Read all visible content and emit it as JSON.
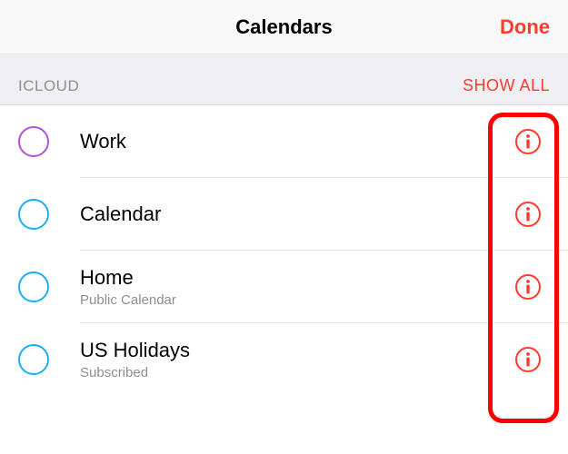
{
  "header": {
    "title": "Calendars",
    "done_label": "Done"
  },
  "section": {
    "label": "ICLOUD",
    "show_all_label": "SHOW ALL"
  },
  "calendars": [
    {
      "name": "Work",
      "subtitle": "",
      "color": "#af52de"
    },
    {
      "name": "Calendar",
      "subtitle": "",
      "color": "#1badf8"
    },
    {
      "name": "Home",
      "subtitle": "Public Calendar",
      "color": "#1badf8"
    },
    {
      "name": "US Holidays",
      "subtitle": "Subscribed",
      "color": "#1badf8"
    }
  ],
  "icons": {
    "info_color": "#ff3b30"
  }
}
